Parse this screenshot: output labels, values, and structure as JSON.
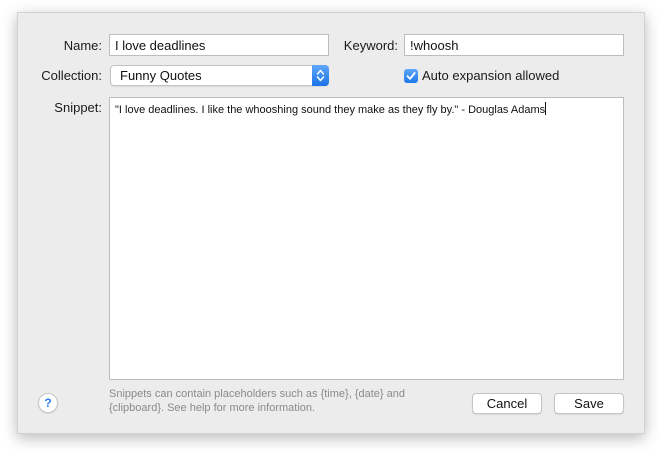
{
  "form": {
    "name_label": "Name:",
    "name_value": "I love deadlines",
    "keyword_label": "Keyword:",
    "keyword_value": "!whoosh",
    "collection_label": "Collection:",
    "collection_value": "Funny Quotes",
    "auto_expansion_label": "Auto expansion allowed",
    "auto_expansion_checked": true,
    "snippet_label": "Snippet:",
    "snippet_value": "\"I love deadlines. I like the whooshing sound they make as they fly by.\" - Douglas Adams"
  },
  "footer": {
    "help_symbol": "?",
    "hint_text": "Snippets can contain placeholders such as {time}, {date} and {clipboard}. See help for more information.",
    "cancel_label": "Cancel",
    "save_label": "Save"
  },
  "colors": {
    "accent": "#1f78ea",
    "sheet_background": "#ececec",
    "hint_text": "#8a8a8a"
  },
  "icons": {
    "collection_select": "chevron-up-down-icon",
    "auto_expansion": "checkmark-icon",
    "help": "question-mark-icon"
  }
}
